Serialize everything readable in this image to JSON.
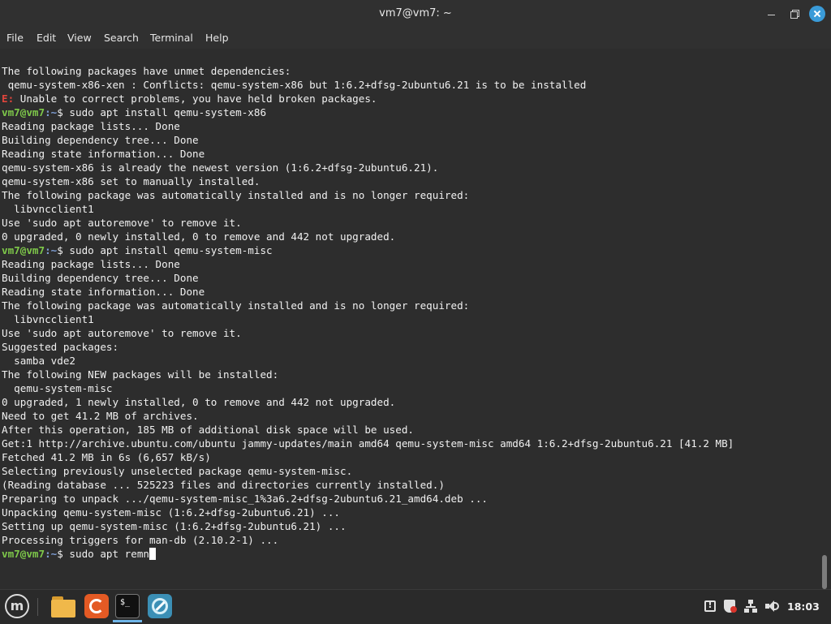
{
  "window": {
    "title": "vm7@vm7: ~"
  },
  "menu": [
    "File",
    "Edit",
    "View",
    "Search",
    "Terminal",
    "Help"
  ],
  "prompt": {
    "user": "vm7@vm7",
    "path": ":~",
    "symbol": "$"
  },
  "terminal": {
    "lines": [
      "The following packages have unmet dependencies:",
      " qemu-system-x86-xen : Conflicts: qemu-system-x86 but 1:6.2+dfsg-2ubuntu6.21 is to be installed",
      {
        "err": "E:",
        "rest": " Unable to correct problems, you have held broken packages."
      },
      {
        "cmd": " sudo apt install qemu-system-x86"
      },
      "Reading package lists... Done",
      "Building dependency tree... Done",
      "Reading state information... Done",
      "qemu-system-x86 is already the newest version (1:6.2+dfsg-2ubuntu6.21).",
      "qemu-system-x86 set to manually installed.",
      "The following package was automatically installed and is no longer required:",
      "  libvncclient1",
      "Use 'sudo apt autoremove' to remove it.",
      "0 upgraded, 0 newly installed, 0 to remove and 442 not upgraded.",
      {
        "cmd": " sudo apt install qemu-system-misc"
      },
      "Reading package lists... Done",
      "Building dependency tree... Done",
      "Reading state information... Done",
      "The following package was automatically installed and is no longer required:",
      "  libvncclient1",
      "Use 'sudo apt autoremove' to remove it.",
      "Suggested packages:",
      "  samba vde2",
      "The following NEW packages will be installed:",
      "  qemu-system-misc",
      "0 upgraded, 1 newly installed, 0 to remove and 442 not upgraded.",
      "Need to get 41.2 MB of archives.",
      "After this operation, 185 MB of additional disk space will be used.",
      "Get:1 http://archive.ubuntu.com/ubuntu jammy-updates/main amd64 qemu-system-misc amd64 1:6.2+dfsg-2ubuntu6.21 [41.2 MB]",
      "Fetched 41.2 MB in 6s (6,657 kB/s)",
      "Selecting previously unselected package qemu-system-misc.",
      "(Reading database ... 525223 files and directories currently installed.)",
      "Preparing to unpack .../qemu-system-misc_1%3a6.2+dfsg-2ubuntu6.21_amd64.deb ...",
      "Unpacking qemu-system-misc (1:6.2+dfsg-2ubuntu6.21) ...",
      "Setting up qemu-system-misc (1:6.2+dfsg-2ubuntu6.21) ...",
      "Processing triggers for man-db (2.10.2-1) ...",
      {
        "cmd": " sudo apt remn",
        "cursor": true
      }
    ]
  },
  "taskbar": {
    "menu_logo": "m",
    "apps": [
      {
        "name": "files",
        "icon": "folder-icon"
      },
      {
        "name": "firefox",
        "icon": "firefox-icon"
      },
      {
        "name": "terminal",
        "icon": "terminal-icon",
        "label": "$_",
        "active": true
      },
      {
        "name": "web-browser",
        "icon": "compass-icon"
      }
    ],
    "tray": {
      "update_mark": "!",
      "clock": "18:03"
    }
  },
  "colors": {
    "prompt_user": "#7ec84a",
    "prompt_path": "#7f9fd6",
    "error": "#e0453c",
    "terminal_bg": "#2d2d2d",
    "accent": "#3a9bd8"
  }
}
